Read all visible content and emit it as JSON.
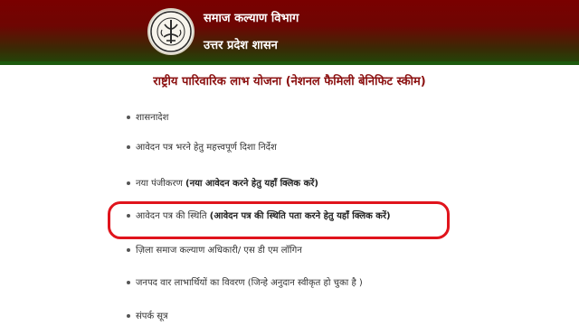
{
  "header": {
    "department": "समाज कल्याण विभाग",
    "government": "उत्तर प्रदेश शासन",
    "emblem_icon": "up-govt-emblem-icon",
    "colors": {
      "top": "#7a0000",
      "bottom": "#1d5a0e"
    }
  },
  "scheme": {
    "title": "राष्ट्रीय पारिवारिक लाभ योजना (नेशनल फैमिली बेनिफिट स्कीम)"
  },
  "menu": {
    "items": [
      {
        "label": "शासनादेश",
        "link": ""
      },
      {
        "label": "आवेदन पत्र भरने हेतु महत्त्वपूर्ण दिशा निर्देश",
        "link": ""
      },
      {
        "label": "नया पंजीकरण ",
        "link": "(नया आवेदन करने हेतु यहाँ क्लिक करें)"
      },
      {
        "label": "आवेदन पत्र की स्थिति ",
        "link": "(आवेदन पत्र की स्थिति पता करने हेतु यहाँ क्लिक करें)"
      },
      {
        "label": "ज़िला समाज कल्याण अधिकारी/ एस डी एम लॉगिन",
        "link": ""
      },
      {
        "label": "जनपद वार लाभार्थियों का विवरण (जिन्हे अनुदान स्वीकृत हो चुका है )",
        "link": ""
      },
      {
        "label": "संपर्क सूत्र",
        "link": ""
      }
    ],
    "highlight_color": "#e0141c"
  }
}
